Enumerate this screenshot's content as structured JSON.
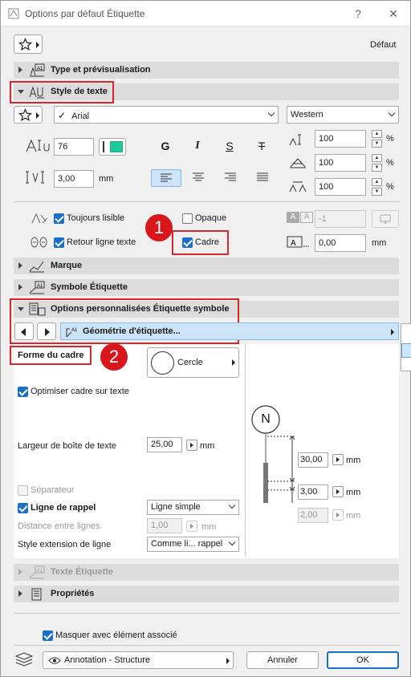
{
  "window": {
    "title": "Options par défaut Étiquette",
    "help": "?",
    "close": "✕"
  },
  "header": {
    "default_label": "Défaut"
  },
  "sections": {
    "type_preview": "Type et prévisualisation",
    "text_style": "Style de texte",
    "marker": "Marque",
    "label_symbol": "Symbole Étiquette",
    "custom_options": "Options personnalisées Étiquette symbole",
    "label_text": "Texte Étiquette",
    "properties": "Propriétés"
  },
  "text_style": {
    "font": "Arial",
    "script": "Western",
    "size": "76",
    "spacing": "3,00",
    "spacing_unit": "mm",
    "bold": "G",
    "italic": "I",
    "underline": "S",
    "strike": "T",
    "width_factor": "100",
    "slant": "100",
    "char_spacing": "100",
    "percent": "%",
    "always_readable": "Toujours lisible",
    "wrap_text": "Retour ligne texte",
    "opaque": "Opaque",
    "frame": "Cadre",
    "pen_value": "-1",
    "frame_offset": "0,00",
    "frame_offset_unit": "mm",
    "accent_color": "#1fc99a"
  },
  "custom": {
    "page_name": "Géométrie d'étiquette...",
    "frame_shape_label": "Forme du cadre",
    "frame_shape_value": "Cercle",
    "optimize_frame": "Optimiser cadre sur texte",
    "text_box_width_label": "Largeur de boîte de texte",
    "text_box_width": "25,00",
    "separator": "Séparateur",
    "leader_line": "Ligne de rappel",
    "leader_line_value": "Ligne simple",
    "line_distance_label": "Distance entre lignes",
    "line_distance": "1,00",
    "extension_style_label": "Style extension de ligne",
    "extension_style_value": "Comme li... rappel",
    "unit": "mm",
    "dim_top": "30,00",
    "dim_mid": "3,00",
    "dim_low": "2,00",
    "preview_letter": "N"
  },
  "footer": {
    "hide_with_element": "Masquer avec élément associé",
    "layer": "Annotation - Structure",
    "cancel": "Annuler",
    "ok": "OK"
  },
  "annotations": {
    "badge1": "1",
    "badge2": "2"
  }
}
